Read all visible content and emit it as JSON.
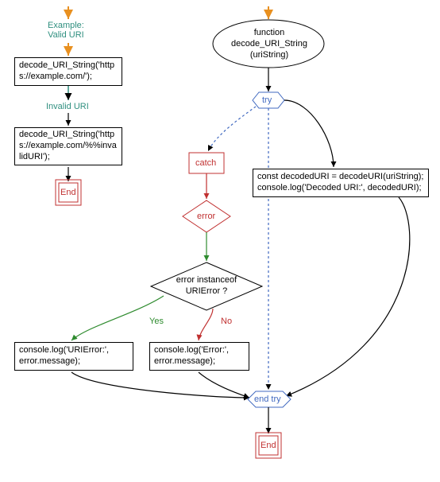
{
  "left": {
    "example_valid": "Example:\nValid URI",
    "call1": "decode_URI_String('https://example.com/');",
    "invalid_uri": "Invalid URI",
    "call2": "decode_URI_String('https://example.com/%%invalidURI');",
    "end": "End"
  },
  "main": {
    "func": "function\ndecode_URI_String\n(uriString)",
    "try": "try",
    "catch": "catch",
    "error": "error",
    "cond": "error instanceof\nURIError ?",
    "yes": "Yes",
    "no": "No",
    "log_uri": "console.log('URIError:',\nerror.message);",
    "log_err": "console.log('Error:',\nerror.message);",
    "body": "const decodedURI = decodeURI(uriString);\nconsole.log('Decoded URI:', decodedURI);",
    "end_try": "end try",
    "end": "End"
  },
  "colors": {
    "teal": "#2f8f7f",
    "green": "#2e8b2e",
    "red": "#c03030",
    "blue": "#4169c0",
    "orange": "#e89020"
  }
}
